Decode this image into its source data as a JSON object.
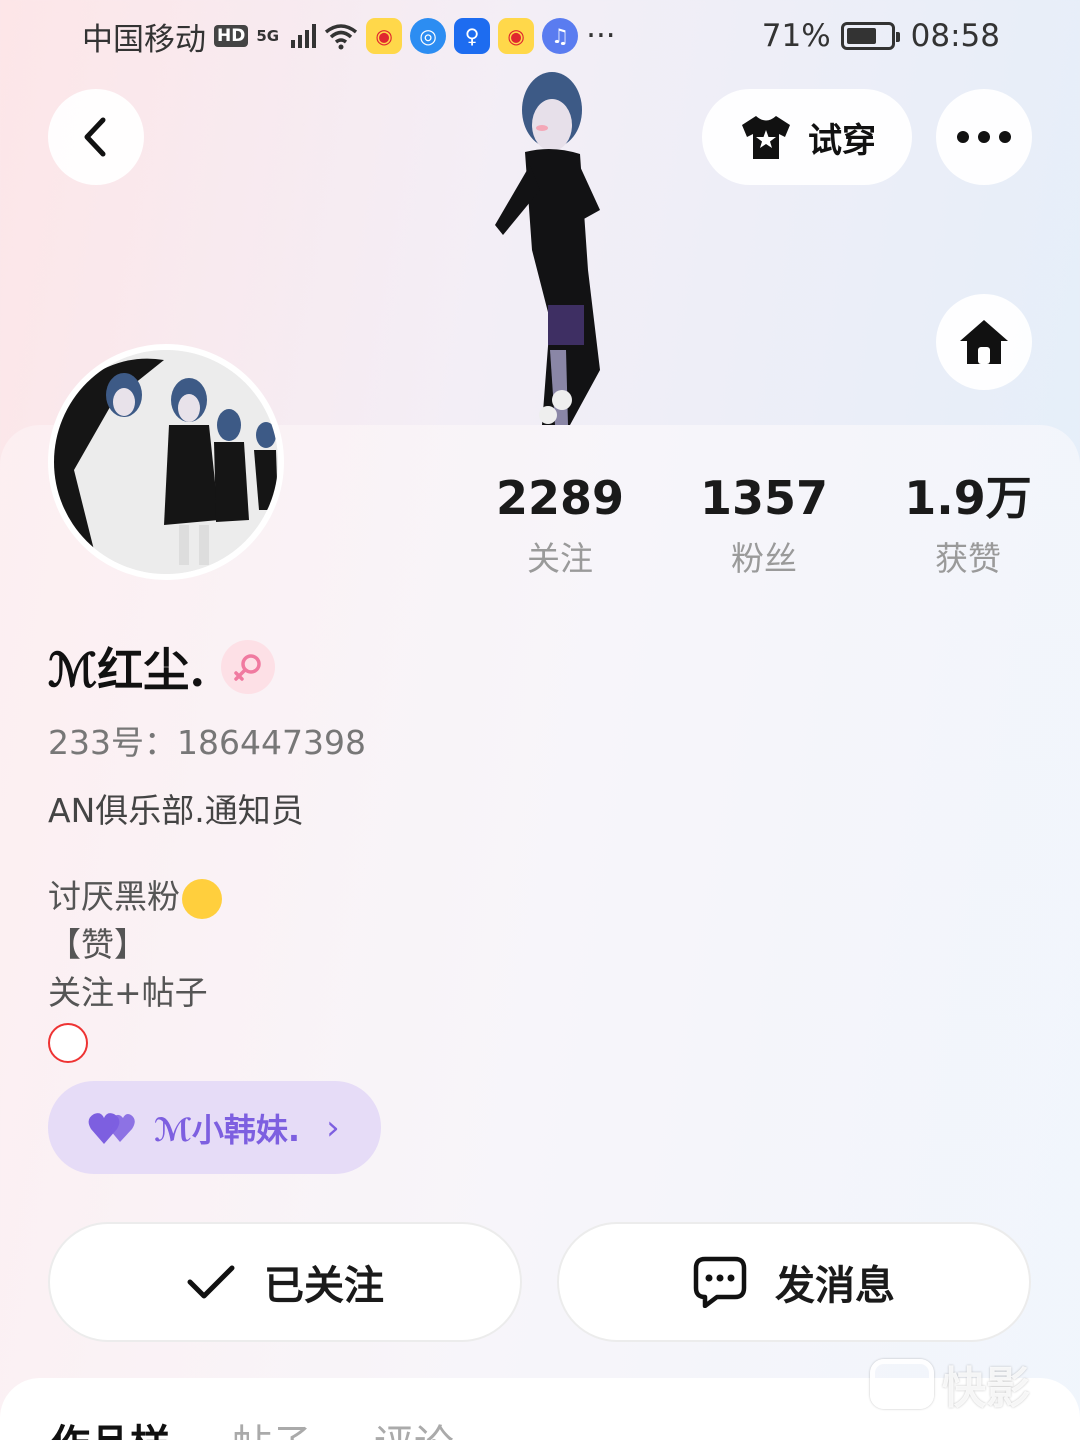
{
  "status_bar": {
    "carrier": "中国移动",
    "hd": "HD",
    "network": "5G",
    "battery_percent": "71%",
    "battery_level": 0.71,
    "time": "08:58",
    "overflow": "···",
    "app_icons": [
      "weibo-icon",
      "browser-icon",
      "lightbulb-app-icon",
      "weibo-icon",
      "music-icon"
    ]
  },
  "header": {
    "back_icon": "chevron-left-icon",
    "try_on_label": "试穿",
    "try_on_icon": "tshirt-star-icon",
    "more_icon": "ellipsis-icon",
    "home_icon": "home-icon"
  },
  "profile": {
    "stats": [
      {
        "value": "2289",
        "label": "关注"
      },
      {
        "value": "1357",
        "label": "粉丝"
      },
      {
        "value": "1.9万",
        "label": "获赞"
      }
    ],
    "username": "ℳ红尘.",
    "gender_icon": "female-icon",
    "uid": "233号：186447398",
    "bio_line1": "AN俱乐部.通知员",
    "bio_lines": [
      "讨厌黑粉",
      "【赞】",
      "关注+帖子"
    ],
    "partner": {
      "icon": "double-heart-icon",
      "name": "ℳ小韩妹.",
      "chevron": "›"
    }
  },
  "actions": {
    "follow_label": "已关注",
    "message_label": "发消息"
  },
  "tabs": [
    "作品样",
    "帖子",
    "评论"
  ],
  "watermark": "快影",
  "colors": {
    "accent_purple": "#7d5fe0",
    "pill_bg": "#e6dcf7",
    "gender_bg": "#fde0e6",
    "gender_fg": "#f07aa0"
  }
}
